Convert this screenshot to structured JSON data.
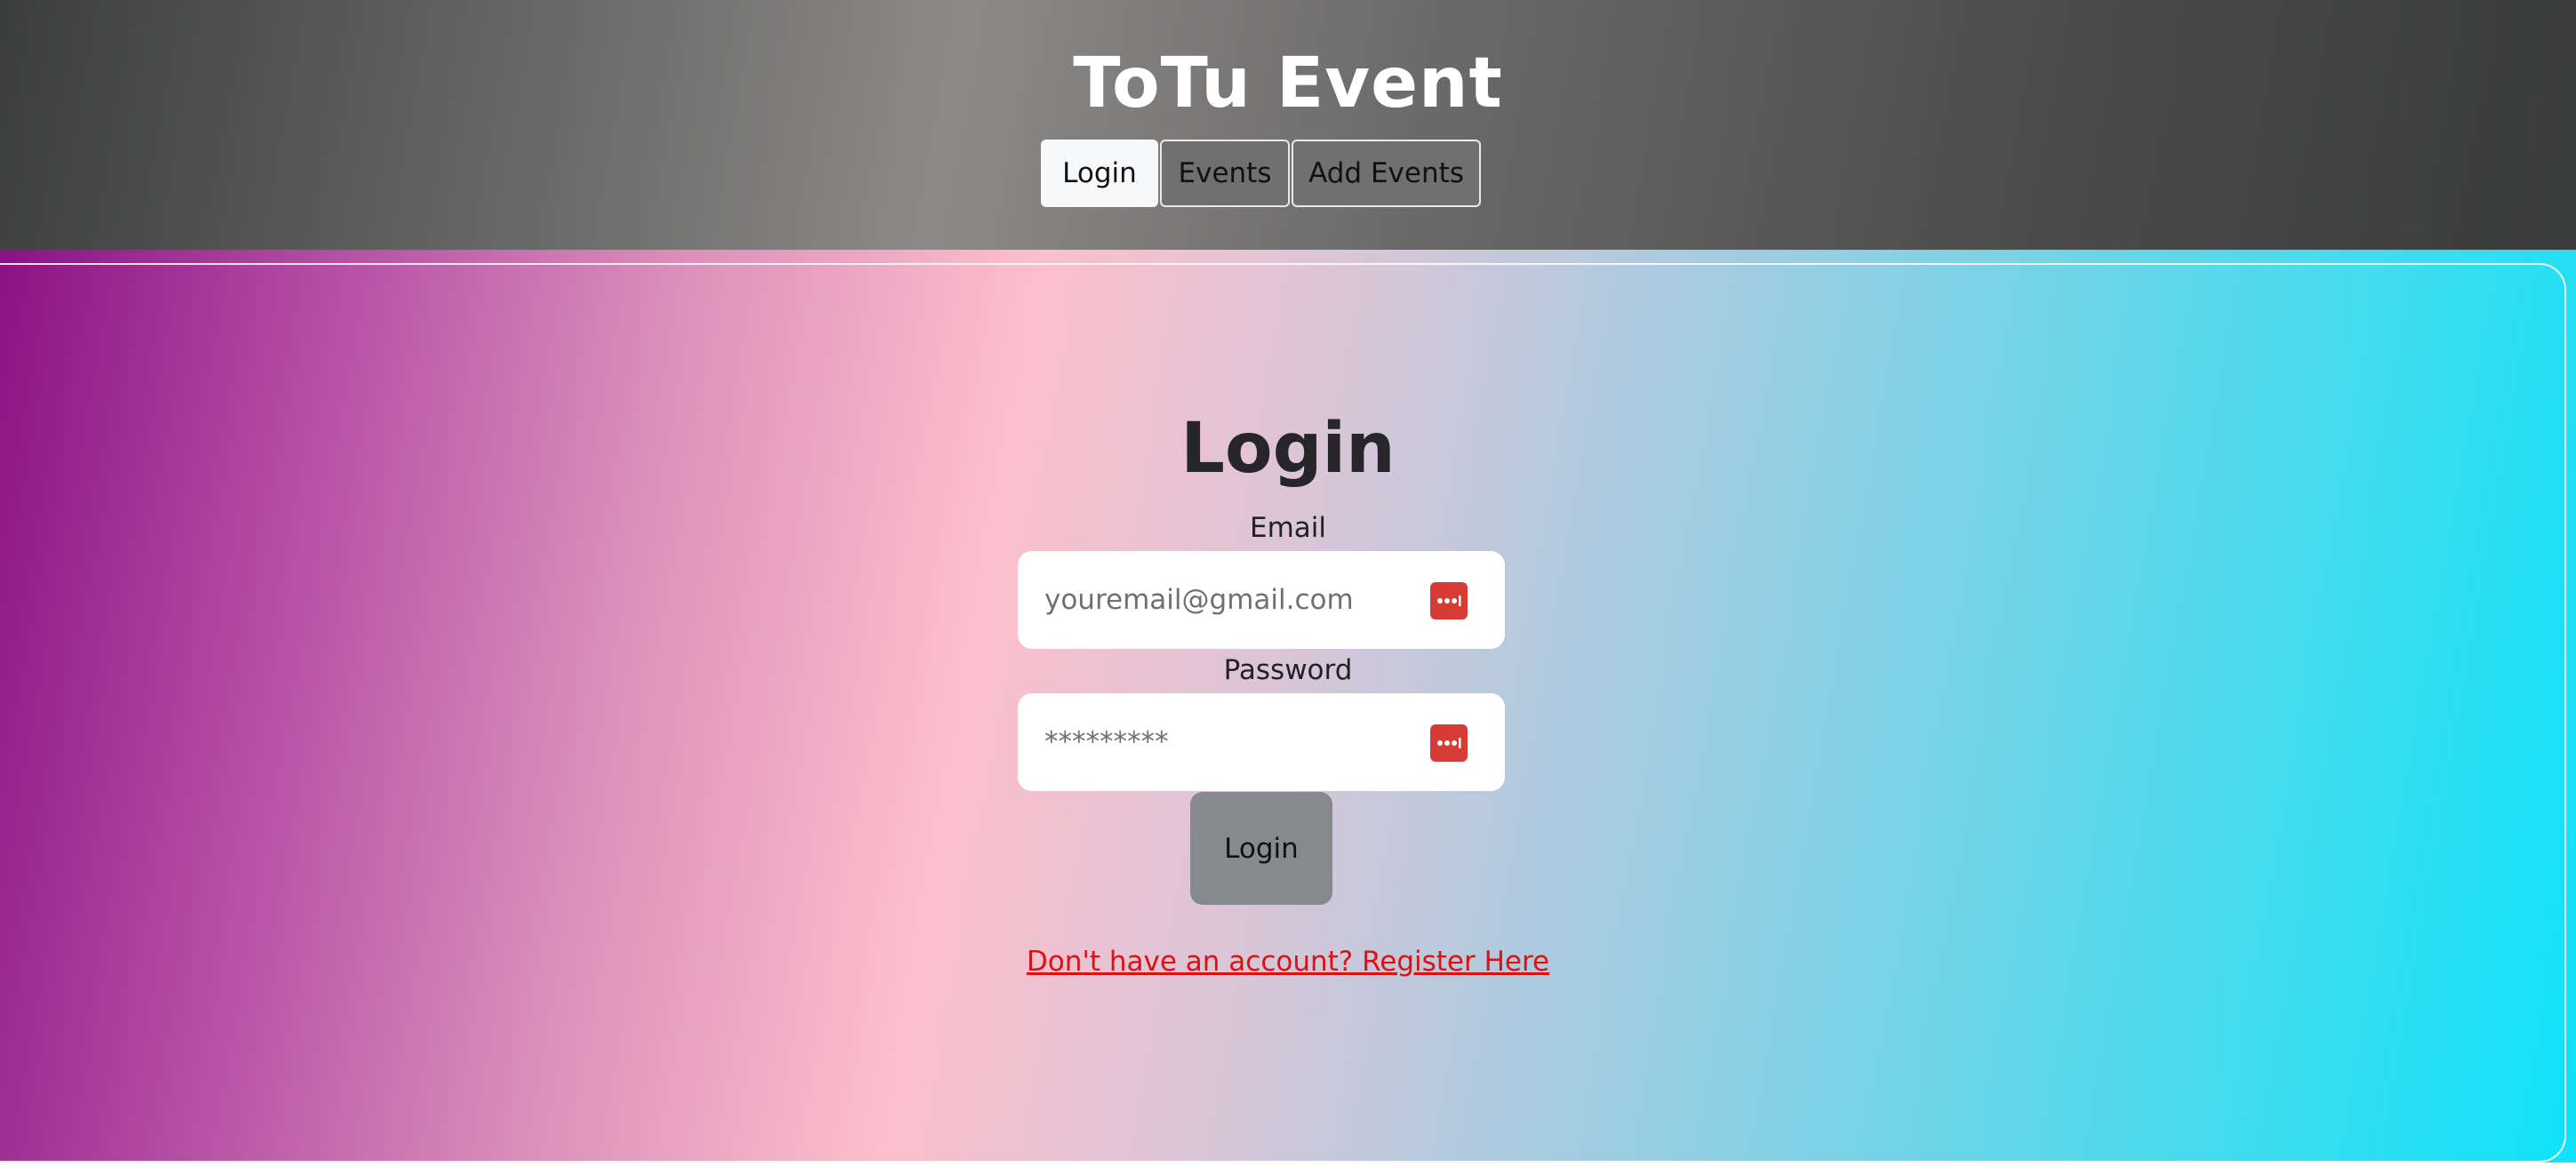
{
  "header": {
    "title": "ToTu Event",
    "nav": [
      {
        "label": "Login",
        "active": true
      },
      {
        "label": "Events",
        "active": false
      },
      {
        "label": "Add Events",
        "active": false
      }
    ]
  },
  "login_form": {
    "title": "Login",
    "email_label": "Email",
    "email_placeholder": "youremail@gmail.com",
    "password_label": "Password",
    "password_placeholder": "*********",
    "submit_label": "Login",
    "register_link": "Don't have an account? Register Here"
  },
  "icons": {
    "field_icon": "password-manager-icon"
  },
  "colors": {
    "password_manager_icon": "#d63b35",
    "register_link": "#e01010",
    "login_button": "#878a8c",
    "nav_active": "#f7f8fa",
    "nav_inactive": "#707070"
  }
}
